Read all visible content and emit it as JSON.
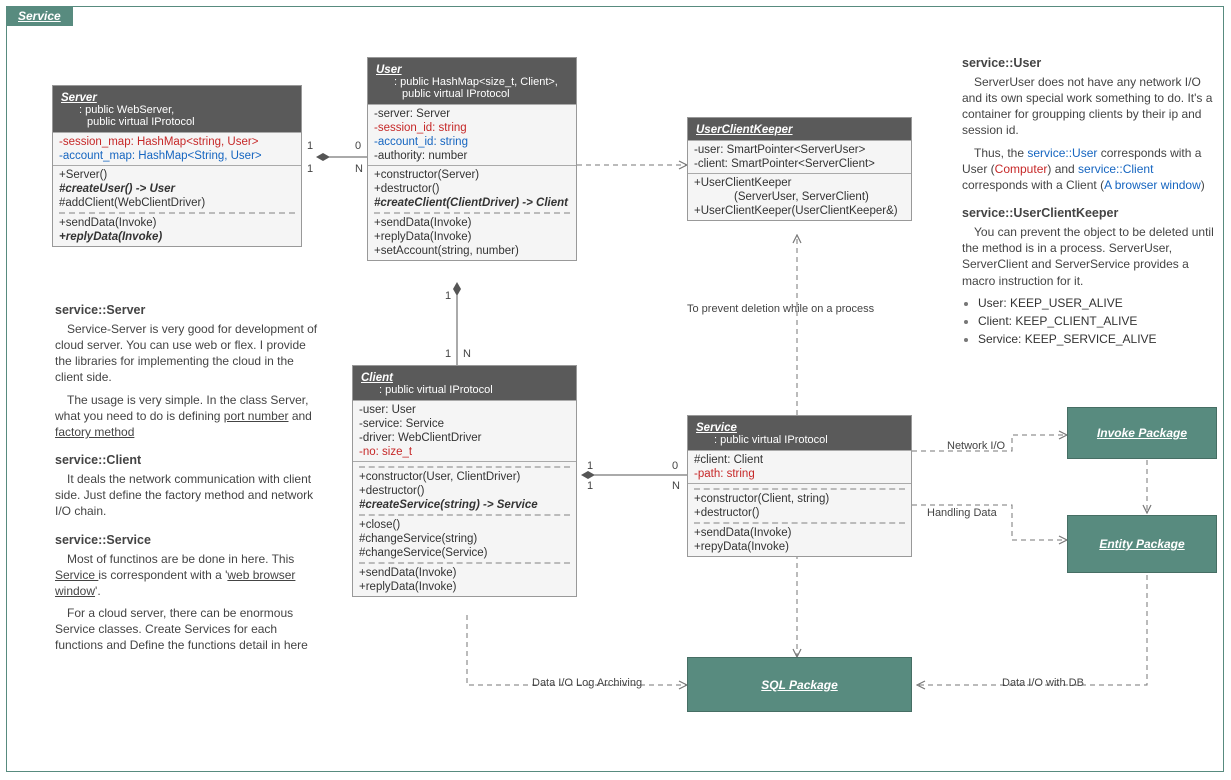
{
  "package_tab": "Service",
  "connector_labels": {
    "prevent_deletion": "To prevent deletion while on a process",
    "network_io": "Network I/O",
    "handling_data": "Handling Data",
    "log_archiving": "Data I/O Log Archiving",
    "data_io_db": "Data I/O with DB"
  },
  "multiplicities": {
    "server_user_left_top": "1",
    "server_user_left_bot": "1",
    "server_user_right_top": "0",
    "server_user_right_bot": "N",
    "user_client_top": "1",
    "user_client_bot_left": "1",
    "user_client_bot_right": "N",
    "client_service_left_top": "1",
    "client_service_left_bot": "1",
    "client_service_right_top": "0",
    "client_service_right_bot": "N"
  },
  "classes": {
    "server": {
      "name": "Server",
      "inherits1": ": public WebServer,",
      "inherits2": "public virtual IProtocol",
      "attr1": "-session_map: HashMap<string, User>",
      "attr2": "-account_map: HashMap<String, User>",
      "op1": "+Server()",
      "op2": "#createUser() -> User",
      "op3": "#addClient(WebClientDriver)",
      "op4": "+sendData(Invoke)",
      "op5": "+replyData(Invoke)"
    },
    "user": {
      "name": "User",
      "inherits1": ": public HashMap<size_t, Client>,",
      "inherits2": "public virtual IProtocol",
      "attr1": "-server: Server",
      "attr2": "-session_id: string",
      "attr3": "-account_id: string",
      "attr4": "-authority: number",
      "op1": "+constructor(Server)",
      "op2": "+destructor()",
      "op3": "#createClient(ClientDriver) -> Client",
      "op4": "+sendData(Invoke)",
      "op5": "+replyData(Invoke)",
      "op6": "+setAccount(string, number)"
    },
    "userclientkeeper": {
      "name": "UserClientKeeper",
      "attr1": "-user: SmartPointer<ServerUser>",
      "attr2": "-client: SmartPointer<ServerClient>",
      "op1": "+UserClientKeeper",
      "op1b": "(ServerUser, ServerClient)",
      "op2": "+UserClientKeeper(UserClientKeeper&)"
    },
    "client": {
      "name": "Client",
      "inherits1": ": public virtual IProtocol",
      "attr1": "-user: User",
      "attr2": "-service: Service",
      "attr3": "-driver: WebClientDriver",
      "attr4": "-no: size_t",
      "op1": "+constructor(User, ClientDriver)",
      "op2": "+destructor()",
      "op3": "#createService(string) -> Service",
      "op4": "+close()",
      "op5": "#changeService(string)",
      "op6": "#changeService(Service)",
      "op7": "+sendData(Invoke)",
      "op8": "+replyData(Invoke)"
    },
    "service": {
      "name": "Service",
      "inherits1": ": public virtual IProtocol",
      "attr1": "#client: Client",
      "attr2": "-path: string",
      "op1": "+constructor(Client, string)",
      "op2": "+destructor()",
      "op3": "+sendData(Invoke)",
      "op4": "+repyData(Invoke)"
    }
  },
  "green_packages": {
    "invoke": "Invoke Package",
    "entity": "Entity Package",
    "sql": "SQL Package"
  },
  "left_desc": {
    "h1": "service::Server",
    "p1a": "Service-Server is very good for development of cloud server. You can use web or flex. I provide the libraries for implementing the cloud in the client side.",
    "p1b_pre": "The usage is very simple. In the class Server, what you need to do is defining ",
    "p1b_u1": "port number",
    "p1b_mid": " and ",
    "p1b_u2": "factory method",
    "h2": "service::Client",
    "p2": "It deals the network communication with client side. Just define the factory method and network I/O chain.",
    "h3": "service::Service",
    "p3a_pre": "Most of functinos are be done in here. This ",
    "p3a_u1": "Service ",
    "p3a_mid": "is correspondent with a '",
    "p3a_u2": "web browser window",
    "p3a_end": "'.",
    "p3b": "For a cloud server, there can be enormous Service classes. Create Services for each functions and Define the functions detail in here"
  },
  "right_desc": {
    "h1": "service::User",
    "p1": "ServerUser does not have any network I/O and its own special work something to do. It's a container for groupping clients by their ip and session id.",
    "p2_pre": "Thus, the ",
    "p2_blue1": "service::User",
    "p2_mid1": " corresponds with a User (",
    "p2_red1": "Computer",
    "p2_mid2": ") and ",
    "p2_blue2": "service::Client",
    "p2_mid3": " corresponds with a Client (",
    "p2_blue3": "A browser window",
    "p2_end": ")",
    "h2": "service::UserClientKeeper",
    "p3": "You can prevent the object to be deleted until the method is in a process. ServerUser, ServerClient and ServerService provides a macro instruction for it.",
    "li1_label": "User: ",
    "li1_val": "KEEP_USER_ALIVE",
    "li2_label": "Client: ",
    "li2_val": "KEEP_CLIENT_ALIVE",
    "li3_label": "Service: ",
    "li3_val": "KEEP_SERVICE_ALIVE"
  }
}
